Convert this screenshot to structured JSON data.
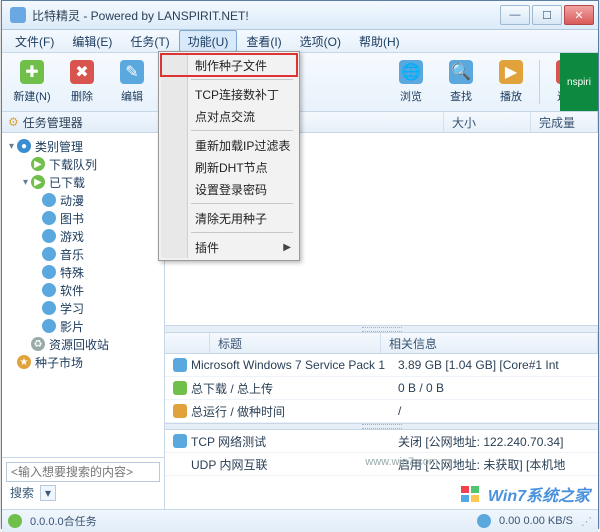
{
  "window": {
    "title": "比特精灵 - Powered by LANSPIRIT.NET!"
  },
  "menus": {
    "file": "文件(F)",
    "edit": "编辑(E)",
    "task": "任务(T)",
    "func": "功能(U)",
    "view": "查看(I)",
    "option": "选项(O)",
    "help": "帮助(H)"
  },
  "toolbar": {
    "new": "新建(N)",
    "delete": "删除",
    "edit": "编辑",
    "browse": "浏览",
    "find": "查找",
    "play": "播放",
    "exit": "退出"
  },
  "dropdown": {
    "make_torrent": "制作种子文件",
    "tcp_patch": "TCP连接数补丁",
    "p2p_exchange": "点对点交流",
    "reload_ipfilter": "重新加载IP过滤表",
    "refresh_dht": "刷新DHT节点",
    "set_password": "设置登录密码",
    "clear_seeds": "清除无用种子",
    "plugins": "插件"
  },
  "sidebar": {
    "task_manager": "任务管理器",
    "category_manager": "类别管理",
    "download_queue": "下载队列",
    "downloaded": "已下载",
    "cats": {
      "anime": "动漫",
      "books": "图书",
      "games": "游戏",
      "music": "音乐",
      "special": "特殊",
      "software": "软件",
      "study": "学习",
      "movies": "影片"
    },
    "recycle": "资源回收站",
    "seed_market": "种子市场",
    "search_placeholder": "<输入想要搜索的内容>",
    "search_btn": "搜索"
  },
  "list": {
    "col_size": "大小",
    "col_progress": "完成量"
  },
  "info": {
    "col_title": "标题",
    "col_related": "相关信息",
    "rows": {
      "sp1_title": "Microsoft Windows 7 Service Pack 1",
      "sp1_info": "3.89 GB [1.04 GB] [Core#1 Int",
      "dlup_label": "总下载 / 总上传",
      "dlup_value": "0 B / 0 B",
      "runtime_label": "总运行 / 做种时间",
      "runtime_value": "/",
      "tcp_label": "TCP 网络测试",
      "tcp_value": "关闭 [公网地址: 122.240.70.34]",
      "udp_label": "UDP 内网互联",
      "udp_value": "启用 [公网地址: 未获取] [本机地"
    }
  },
  "status": {
    "tasks": "0.0.0.0合任务",
    "speed": "0.00 0.00 KB/S"
  },
  "watermark": "Win7系统之家",
  "midwm": "www.win7.com"
}
